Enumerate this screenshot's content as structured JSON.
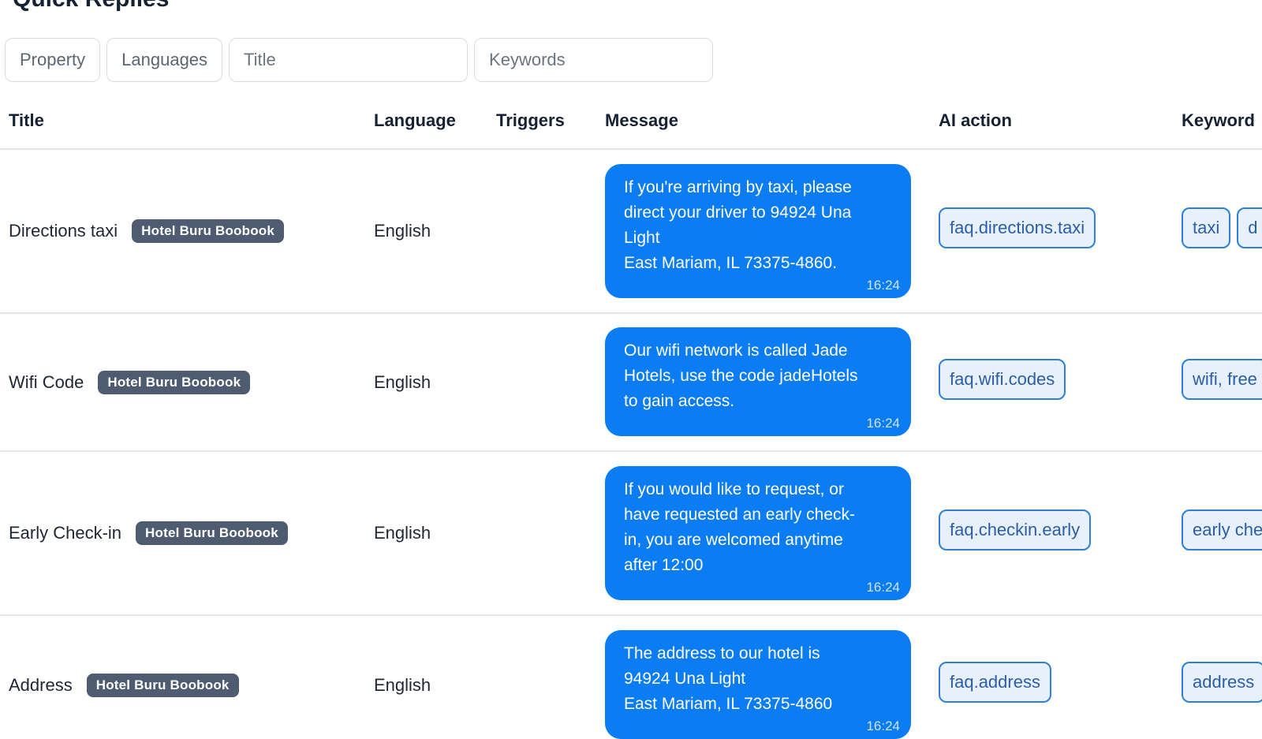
{
  "page": {
    "title": "Quick Replies"
  },
  "filters": {
    "property_label": "Property",
    "languages_label": "Languages",
    "title_placeholder": "Title",
    "keywords_placeholder": "Keywords"
  },
  "table": {
    "headers": {
      "title": "Title",
      "language": "Language",
      "triggers": "Triggers",
      "message": "Message",
      "ai_action": "AI action",
      "keywords": "Keyword"
    },
    "rows": [
      {
        "title": "Directions taxi",
        "property": "Hotel Buru Boobook",
        "language": "English",
        "message": "If you're arriving by taxi, please\ndirect your driver to 94924 Una\nLight\nEast Mariam, IL 73375-4860.",
        "time": "16:24",
        "ai_action": "faq.directions.taxi",
        "keywords": [
          "taxi",
          "d"
        ]
      },
      {
        "title": "Wifi Code",
        "property": "Hotel Buru Boobook",
        "language": "English",
        "message": "Our wifi network is called Jade\nHotels, use the code jadeHotels\nto gain access.",
        "time": "16:24",
        "ai_action": "faq.wifi.codes",
        "keywords": [
          "wifi, free"
        ]
      },
      {
        "title": "Early Check-in",
        "property": "Hotel Buru Boobook",
        "language": "English",
        "message": "If you would like to request, or\nhave requested an early check-\nin, you are welcomed anytime\nafter 12:00",
        "time": "16:24",
        "ai_action": "faq.checkin.early",
        "keywords": [
          "early che"
        ]
      },
      {
        "title": "Address",
        "property": "Hotel Buru Boobook",
        "language": "English",
        "message": "The address to our hotel is\n94924 Una Light\nEast Mariam, IL 73375-4860",
        "time": "16:24",
        "ai_action": "faq.address",
        "keywords": [
          "address"
        ]
      }
    ]
  }
}
